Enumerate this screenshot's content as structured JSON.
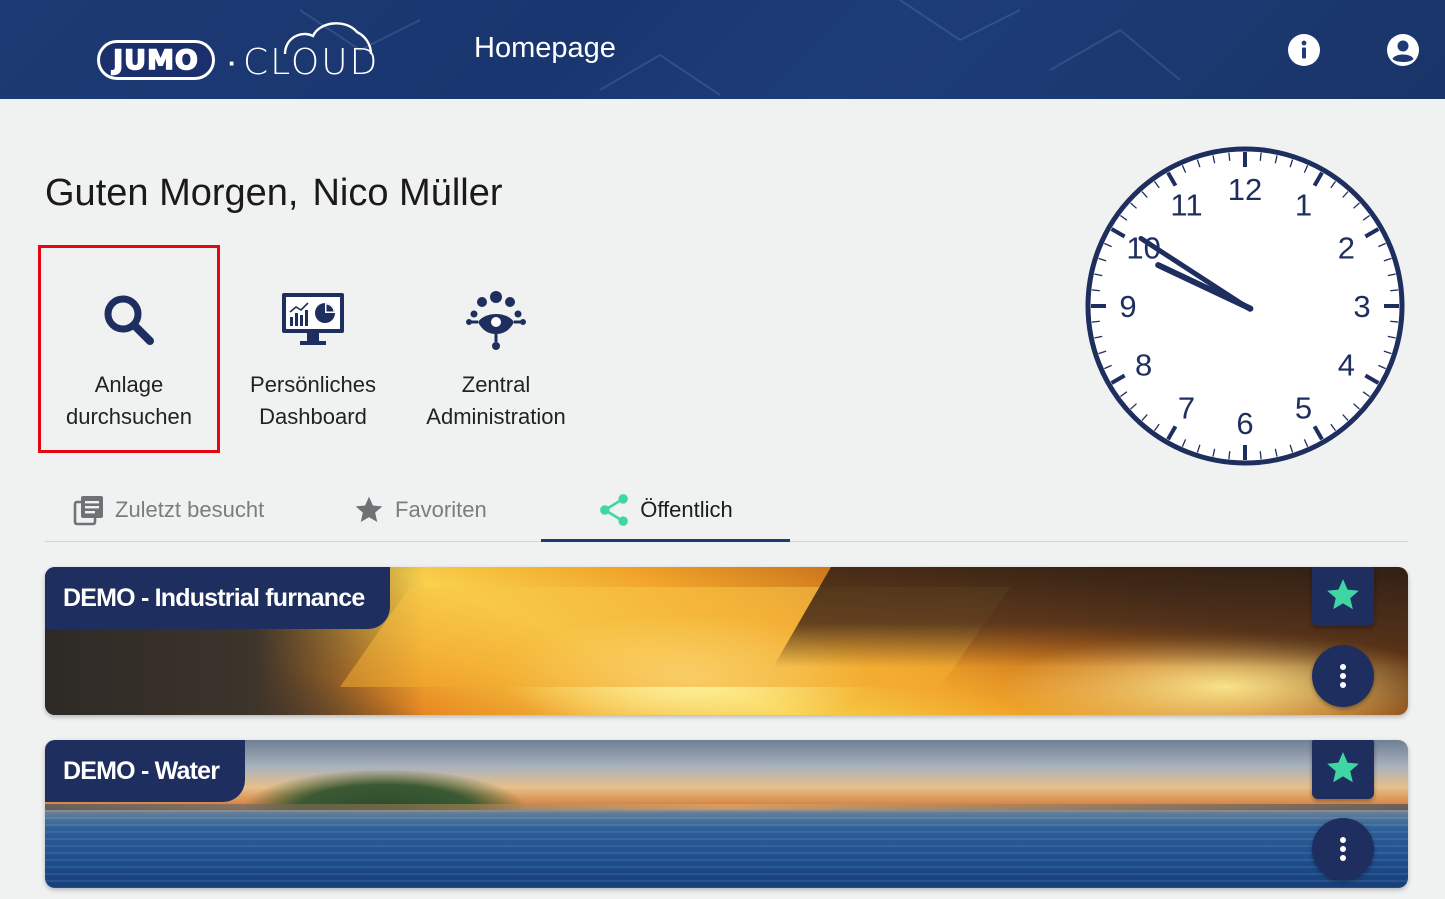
{
  "header": {
    "logo_brand": "JUMO",
    "logo_separator": "·",
    "logo_product": "CLOUD",
    "title": "Homepage",
    "info_icon": "info-icon",
    "user_icon": "account-circle-icon"
  },
  "greeting": {
    "salutation": "Guten Morgen,",
    "user_name": "Nico Müller"
  },
  "actions": [
    {
      "label": "Anlage\ndurchsuchen",
      "icon": "search-icon",
      "highlighted": true
    },
    {
      "label": "Persönliches\nDashboard",
      "icon": "dashboard-monitor-icon",
      "highlighted": false
    },
    {
      "label": "Zentral\nAdministration",
      "icon": "network-admin-icon",
      "highlighted": false
    }
  ],
  "clock": {
    "numbers": [
      "12",
      "1",
      "2",
      "3",
      "4",
      "5",
      "6",
      "7",
      "8",
      "9",
      "10",
      "11"
    ],
    "hour": 9,
    "minute": 50.5,
    "color": "#1e2e5e"
  },
  "tabs": [
    {
      "label": "Zuletzt besucht",
      "icon": "history-icon",
      "active": false
    },
    {
      "label": "Favoriten",
      "icon": "star-icon",
      "active": false
    },
    {
      "label": "Öffentlich",
      "icon": "share-icon",
      "active": true
    }
  ],
  "cards": [
    {
      "title": "DEMO - Industrial furnance",
      "favorite": true
    },
    {
      "title": "DEMO - Water",
      "favorite": true
    }
  ],
  "colors": {
    "header_bg": "#1c3a73",
    "accent_navy": "#1e2e5e",
    "share_green": "#3fd6a4",
    "star_green": "#3fd6a4",
    "highlight_red": "#e30613"
  }
}
